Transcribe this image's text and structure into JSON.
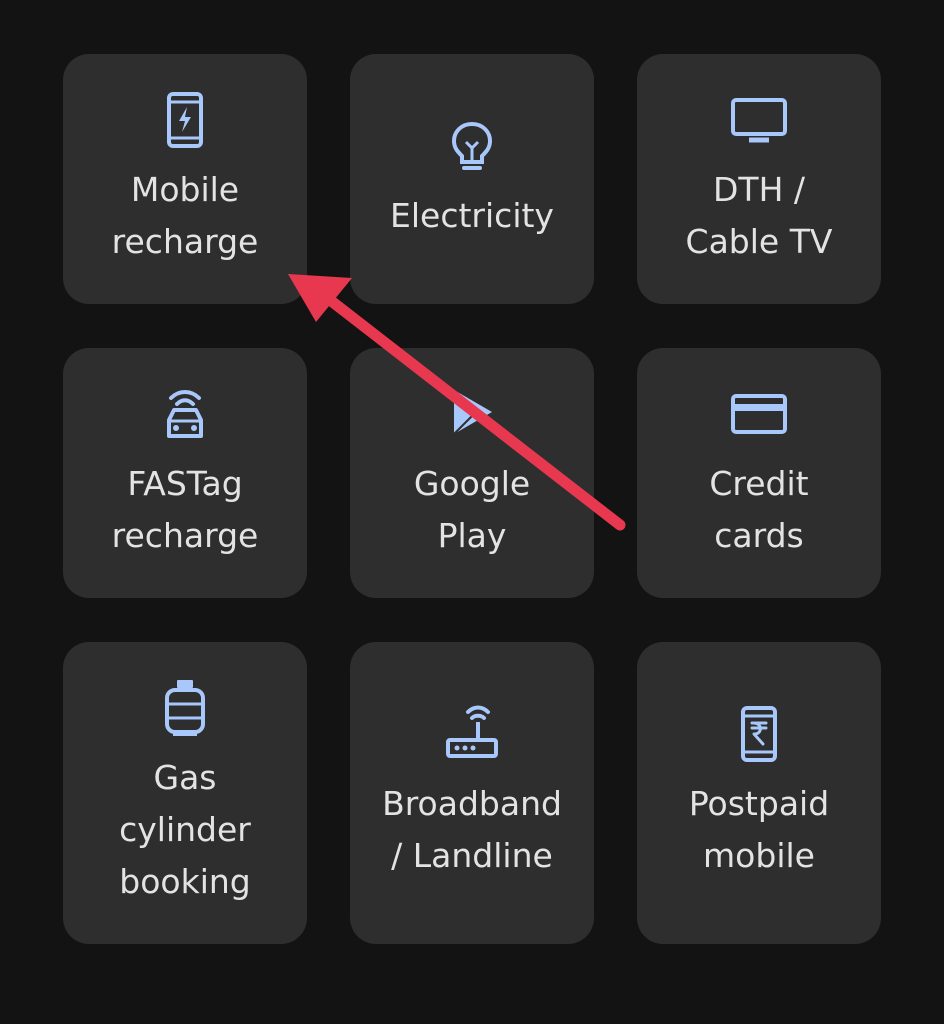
{
  "theme": {
    "background": "#131313",
    "tile_background": "#2e2e2e",
    "icon_color": "#a8c7fa",
    "text_color": "#e3e3e3",
    "annotation_arrow_color": "#e8384f"
  },
  "tiles": [
    {
      "id": "mobile-recharge",
      "icon": "phone-bolt-icon",
      "lines": [
        "Mobile",
        "recharge"
      ]
    },
    {
      "id": "electricity",
      "icon": "lightbulb-icon",
      "lines": [
        "Electricity"
      ]
    },
    {
      "id": "dth-cable-tv",
      "icon": "tv-icon",
      "lines": [
        "DTH /",
        "Cable TV"
      ]
    },
    {
      "id": "fastag-recharge",
      "icon": "car-signal-icon",
      "lines": [
        "FASTag",
        "recharge"
      ]
    },
    {
      "id": "google-play",
      "icon": "google-play-icon",
      "lines": [
        "Google",
        "Play"
      ]
    },
    {
      "id": "credit-cards",
      "icon": "credit-card-icon",
      "lines": [
        "Credit",
        "cards"
      ]
    },
    {
      "id": "gas-cylinder-booking",
      "icon": "gas-cylinder-icon",
      "lines": [
        "Gas",
        "cylinder",
        "booking"
      ]
    },
    {
      "id": "broadband-landline",
      "icon": "router-icon",
      "lines": [
        "Broadband",
        "/ Landline"
      ]
    },
    {
      "id": "postpaid-mobile",
      "icon": "phone-rupee-icon",
      "lines": [
        "Postpaid",
        "mobile"
      ]
    }
  ]
}
